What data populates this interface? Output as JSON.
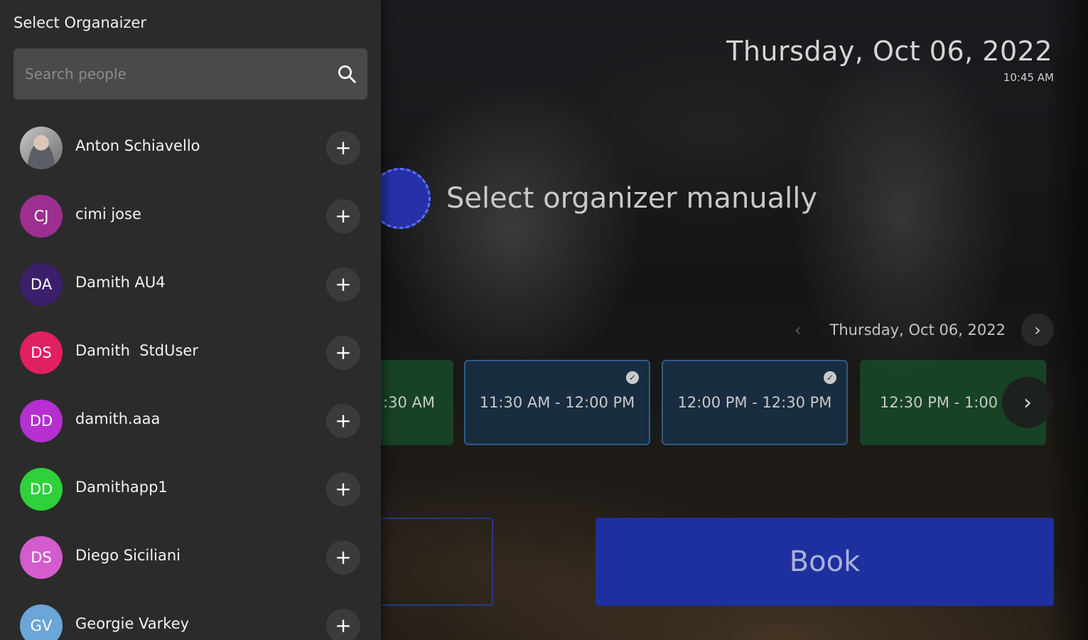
{
  "header": {
    "date": "Thursday, Oct 06, 2022",
    "time": "10:45 AM"
  },
  "organizer_prompt": "Select organizer manually",
  "day_nav": {
    "label": "Thursday, Oct 06, 2022",
    "prev_icon": "chevron-left-icon",
    "next_icon": "chevron-right-icon"
  },
  "slots": [
    {
      "label": ":30 AM",
      "status": "available",
      "selected": false
    },
    {
      "label": "11:30 AM - 12:00 PM",
      "status": "selected",
      "selected": true
    },
    {
      "label": "12:00 PM - 12:30 PM",
      "status": "selected",
      "selected": true
    },
    {
      "label": "12:30 PM - 1:00",
      "status": "available",
      "selected": false
    }
  ],
  "book_label": "Book",
  "sidebar": {
    "title": "Select Organaizer",
    "search_placeholder": "Search people",
    "people": [
      {
        "name": "Anton Schiavello",
        "initials": "",
        "color": "#7a7a7a",
        "photo": true
      },
      {
        "name": "cimi jose",
        "initials": "CJ",
        "color": "#9c2f8f",
        "photo": false
      },
      {
        "name": "Damith AU4",
        "initials": "DA",
        "color": "#3c1f6b",
        "photo": false
      },
      {
        "name": "Damith  StdUser",
        "initials": "DS",
        "color": "#e11f63",
        "photo": false
      },
      {
        "name": "damith.aaa",
        "initials": "DD",
        "color": "#b52fd1",
        "photo": false
      },
      {
        "name": "Damithapp1",
        "initials": "DD",
        "color": "#2fd13a",
        "photo": false
      },
      {
        "name": "Diego Siciliani",
        "initials": "DS",
        "color": "#d45ccd",
        "photo": false
      },
      {
        "name": "Georgie Varkey",
        "initials": "GV",
        "color": "#6aa6d8",
        "photo": false
      }
    ]
  },
  "colors": {
    "accent": "#1e2fa0",
    "sidebar_bg": "#2b2b2b",
    "slot_available": "#184a28",
    "slot_selected": "#183044"
  }
}
